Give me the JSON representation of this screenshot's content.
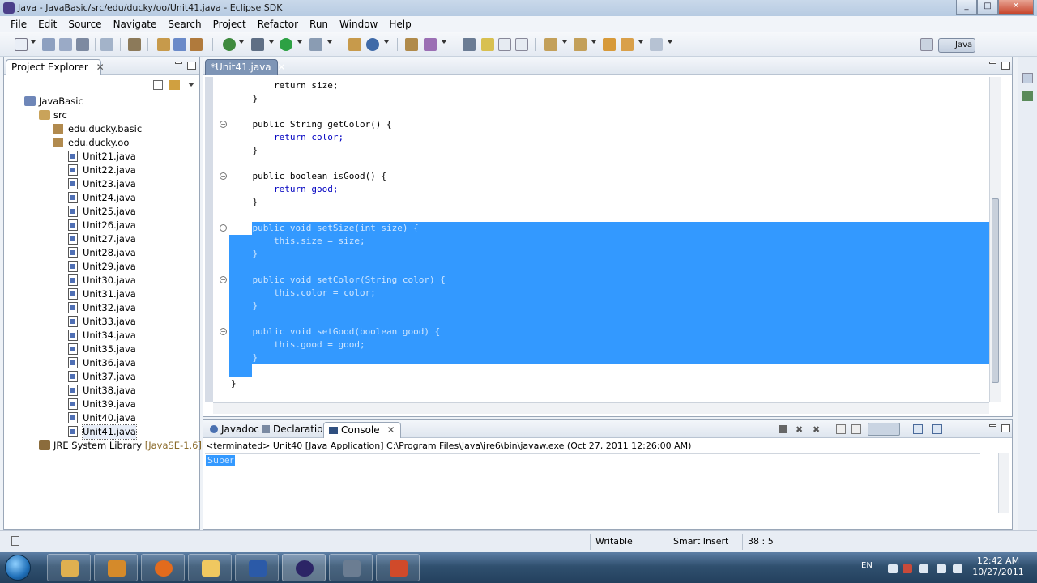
{
  "window": {
    "title": "Java - JavaBasic/src/edu/ducky/oo/Unit41.java - Eclipse SDK",
    "controls": [
      "_",
      "□",
      "✕"
    ]
  },
  "menu": [
    "File",
    "Edit",
    "Source",
    "Navigate",
    "Search",
    "Project",
    "Refactor",
    "Run",
    "Window",
    "Help"
  ],
  "perspective": {
    "label": "Java"
  },
  "project_explorer": {
    "tab_label": "Project Explorer",
    "tree": {
      "project": "JavaBasic",
      "src": "src",
      "packages": [
        "edu.ducky.basic",
        "edu.ducky.oo"
      ],
      "files": [
        "Unit21.java",
        "Unit22.java",
        "Unit23.java",
        "Unit24.java",
        "Unit25.java",
        "Unit26.java",
        "Unit27.java",
        "Unit28.java",
        "Unit29.java",
        "Unit30.java",
        "Unit31.java",
        "Unit32.java",
        "Unit33.java",
        "Unit34.java",
        "Unit35.java",
        "Unit36.java",
        "Unit37.java",
        "Unit38.java",
        "Unit39.java",
        "Unit40.java",
        "Unit41.java"
      ],
      "selected_file": "Unit41.java",
      "library": "JRE System Library",
      "library_version": "[JavaSE-1.6]"
    }
  },
  "editor": {
    "tab_label": "*Unit41.java",
    "lines": [
      "        return size;",
      "    }",
      "",
      "    public String getColor() {",
      "        return color;",
      "    }",
      "",
      "    public boolean isGood() {",
      "        return good;",
      "    }",
      "",
      "    public void setSize(int size) {",
      "        this.size = size;",
      "    }",
      "",
      "    public void setColor(String color) {",
      "        this.color = color;",
      "    }",
      "",
      "    public void setGood(boolean good) {",
      "        this.good = good;",
      "    }",
      "}"
    ],
    "selection": "setSize / setColor / setGood methods"
  },
  "bottom_tabs": [
    "Javadoc",
    "Declaration",
    "Console"
  ],
  "console": {
    "header": "<terminated> Unit40 [Java Application] C:\\Program Files\\Java\\jre6\\bin\\javaw.exe (Oct 27, 2011 12:26:00 AM)",
    "output": "Super"
  },
  "status": {
    "writable": "Writable",
    "insert_mode": "Smart Insert",
    "position": "38 : 5"
  },
  "taskbar": {
    "lang": "EN",
    "time": "12:42 AM",
    "date": "10/27/2011"
  }
}
